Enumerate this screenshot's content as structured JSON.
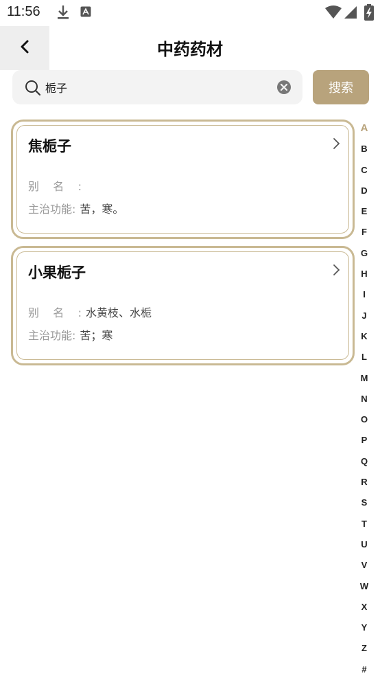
{
  "status_bar": {
    "time": "11:56",
    "icons": [
      "download-icon",
      "font-app-icon",
      "wifi-icon",
      "signal-icon",
      "battery-charging-icon"
    ]
  },
  "header": {
    "title": "中药药材",
    "back_icon": "chevron-left-icon"
  },
  "search": {
    "value": "栀子",
    "button_label": "搜索"
  },
  "results": [
    {
      "name": "焦栀子",
      "alias_label": "别名:",
      "alias": "",
      "function_label": "主治功能:",
      "function": "苦，寒。"
    },
    {
      "name": "小果栀子",
      "alias_label": "别名:",
      "alias": "水黄枝、水栀",
      "function_label": "主治功能:",
      "function": "苦；寒"
    }
  ],
  "alphabet": [
    "A",
    "B",
    "C",
    "D",
    "E",
    "F",
    "G",
    "H",
    "I",
    "J",
    "K",
    "L",
    "M",
    "N",
    "O",
    "P",
    "Q",
    "R",
    "S",
    "T",
    "U",
    "V",
    "W",
    "X",
    "Y",
    "Z",
    "#"
  ],
  "active_letter": "A",
  "colors": {
    "accent": "#b8a37c",
    "card_border": "#c9b993"
  }
}
